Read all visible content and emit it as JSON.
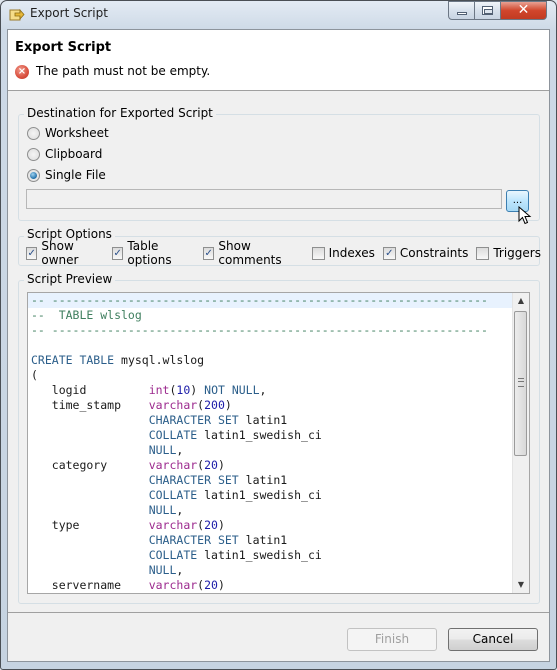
{
  "window": {
    "title": "Export Script",
    "controls": {
      "minimize": "minimize",
      "maximize": "maximize",
      "close": "✕"
    }
  },
  "header": {
    "title": "Export Script",
    "error_message": "The path must not be empty.",
    "error_icon": "×"
  },
  "destination": {
    "label": "Destination for Exported Script",
    "options": [
      {
        "label": "Worksheet",
        "selected": false
      },
      {
        "label": "Clipboard",
        "selected": false
      },
      {
        "label": "Single File",
        "selected": true
      }
    ],
    "path_value": "",
    "browse_label": "..."
  },
  "script_options": {
    "label": "Script Options",
    "items": [
      {
        "label": "Show owner",
        "checked": true
      },
      {
        "label": "Table options",
        "checked": true
      },
      {
        "label": "Show comments",
        "checked": true
      },
      {
        "label": "Indexes",
        "checked": false
      },
      {
        "label": "Constraints",
        "checked": true
      },
      {
        "label": "Triggers",
        "checked": false
      }
    ]
  },
  "preview": {
    "label": "Script Preview",
    "lines": [
      [
        [
          "c-com",
          "-- ---------------------------------------------------------------"
        ]
      ],
      [
        [
          "c-com",
          "--  TABLE wlslog"
        ]
      ],
      [
        [
          "c-com",
          "-- ---------------------------------------------------------------"
        ]
      ],
      [],
      [
        [
          "c-kw",
          "CREATE TABLE "
        ],
        [
          "c-id",
          "mysql.wlslog"
        ]
      ],
      [
        [
          "c-id",
          "("
        ]
      ],
      [
        [
          "c-id",
          "   logid         "
        ],
        [
          "c-type",
          "int"
        ],
        [
          "c-id",
          "("
        ],
        [
          "c-num",
          "10"
        ],
        [
          "c-id",
          ") "
        ],
        [
          "c-kw",
          "NOT NULL"
        ],
        [
          "c-id",
          ","
        ]
      ],
      [
        [
          "c-id",
          "   time_stamp    "
        ],
        [
          "c-type",
          "varchar"
        ],
        [
          "c-id",
          "("
        ],
        [
          "c-num",
          "200"
        ],
        [
          "c-id",
          ")"
        ]
      ],
      [
        [
          "c-id",
          "                 "
        ],
        [
          "c-kw",
          "CHARACTER SET "
        ],
        [
          "c-id",
          "latin1"
        ]
      ],
      [
        [
          "c-id",
          "                 "
        ],
        [
          "c-kw",
          "COLLATE "
        ],
        [
          "c-id",
          "latin1_swedish_ci"
        ]
      ],
      [
        [
          "c-id",
          "                 "
        ],
        [
          "c-kw",
          "NULL"
        ],
        [
          "c-id",
          ","
        ]
      ],
      [
        [
          "c-id",
          "   category      "
        ],
        [
          "c-type",
          "varchar"
        ],
        [
          "c-id",
          "("
        ],
        [
          "c-num",
          "20"
        ],
        [
          "c-id",
          ")"
        ]
      ],
      [
        [
          "c-id",
          "                 "
        ],
        [
          "c-kw",
          "CHARACTER SET "
        ],
        [
          "c-id",
          "latin1"
        ]
      ],
      [
        [
          "c-id",
          "                 "
        ],
        [
          "c-kw",
          "COLLATE "
        ],
        [
          "c-id",
          "latin1_swedish_ci"
        ]
      ],
      [
        [
          "c-id",
          "                 "
        ],
        [
          "c-kw",
          "NULL"
        ],
        [
          "c-id",
          ","
        ]
      ],
      [
        [
          "c-id",
          "   type          "
        ],
        [
          "c-type",
          "varchar"
        ],
        [
          "c-id",
          "("
        ],
        [
          "c-num",
          "20"
        ],
        [
          "c-id",
          ")"
        ]
      ],
      [
        [
          "c-id",
          "                 "
        ],
        [
          "c-kw",
          "CHARACTER SET "
        ],
        [
          "c-id",
          "latin1"
        ]
      ],
      [
        [
          "c-id",
          "                 "
        ],
        [
          "c-kw",
          "COLLATE "
        ],
        [
          "c-id",
          "latin1_swedish_ci"
        ]
      ],
      [
        [
          "c-id",
          "                 "
        ],
        [
          "c-kw",
          "NULL"
        ],
        [
          "c-id",
          ","
        ]
      ],
      [
        [
          "c-id",
          "   servername    "
        ],
        [
          "c-type",
          "varchar"
        ],
        [
          "c-id",
          "("
        ],
        [
          "c-num",
          "20"
        ],
        [
          "c-id",
          ")"
        ]
      ]
    ],
    "highlighted_line": 0,
    "scroll_up": "▲",
    "scroll_down": "▼"
  },
  "footer": {
    "finish_label": "Finish",
    "finish_enabled": false,
    "cancel_label": "Cancel"
  },
  "colors": {
    "error": "#d9503f",
    "accent": "#3c7fb1",
    "comment": "#3f7f5f",
    "keyword": "#2b5e8a",
    "type": "#9c2a8e",
    "number": "#1c1ca8"
  }
}
